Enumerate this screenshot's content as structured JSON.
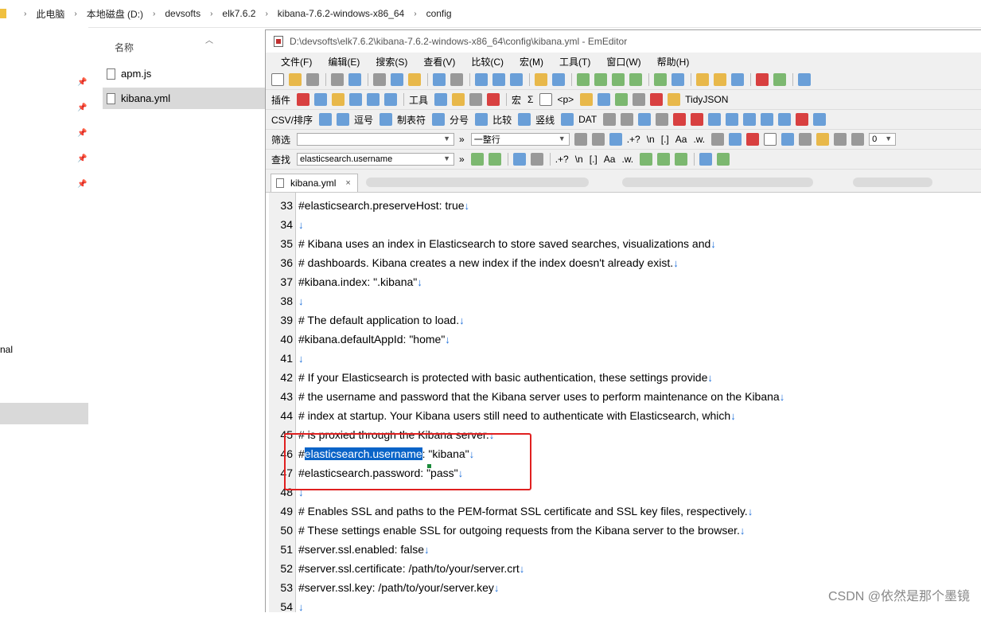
{
  "explorer": {
    "breadcrumbs": [
      "此电脑",
      "本地磁盘 (D:)",
      "devsofts",
      "elk7.6.2",
      "kibana-7.6.2-windows-x86_64",
      "config"
    ],
    "column_header": "名称",
    "files": [
      {
        "name": "apm.js",
        "selected": false
      },
      {
        "name": "kibana.yml",
        "selected": true
      }
    ],
    "nav_partial_label": "nal"
  },
  "editor": {
    "title": "D:\\devsofts\\elk7.6.2\\kibana-7.6.2-windows-x86_64\\config\\kibana.yml - EmEditor",
    "menu": [
      "文件(F)",
      "编辑(E)",
      "搜索(S)",
      "查看(V)",
      "比较(C)",
      "宏(M)",
      "工具(T)",
      "窗口(W)",
      "帮助(H)"
    ],
    "toolbar3": {
      "plugins_label": "插件",
      "tools_label": "工具",
      "macro_label": "宏",
      "sigma_label": "Σ",
      "p_label": "<p>",
      "tidyjson_label": "TidyJSON"
    },
    "toolbar4": {
      "csv_label": "CSV/排序",
      "comma_label": "逗号",
      "tab_label": "制表符",
      "semicolon_label": "分号",
      "compare_label": "比较",
      "pipe_label": "竖线",
      "dat_label": "DAT"
    },
    "filter_bar": {
      "label": "筛选",
      "value": "",
      "mode_value": "一整行",
      "regex_label": ".+?",
      "escape_label": "\\n",
      "bracket_label": "[.]",
      "case_label": "Aa",
      "word_label": ".w.",
      "count_value": "0"
    },
    "find_bar": {
      "label": "查找",
      "value": "elasticsearch.username",
      "regex_label": ".+?",
      "escape_label": "\\n",
      "bracket_label": "[.]",
      "case_label": "Aa",
      "word_label": ".w."
    },
    "tab_label": "kibana.yml",
    "tab_close": "×",
    "lines": [
      {
        "num": "33",
        "text": "#elasticsearch.preserveHost: true"
      },
      {
        "num": "34",
        "text": ""
      },
      {
        "num": "35",
        "text": "# Kibana uses an index in Elasticsearch to store saved searches, visualizations and"
      },
      {
        "num": "36",
        "text": "# dashboards. Kibana creates a new index if the index doesn't already exist."
      },
      {
        "num": "37",
        "text": "#kibana.index: \".kibana\""
      },
      {
        "num": "38",
        "text": ""
      },
      {
        "num": "39",
        "text": "# The default application to load."
      },
      {
        "num": "40",
        "text": "#kibana.defaultAppId: \"home\""
      },
      {
        "num": "41",
        "text": ""
      },
      {
        "num": "42",
        "text": "# If your Elasticsearch is protected with basic authentication, these settings provide"
      },
      {
        "num": "43",
        "text": "# the username and password that the Kibana server uses to perform maintenance on the Kibana"
      },
      {
        "num": "44",
        "text": "# index at startup. Your Kibana users still need to authenticate with Elasticsearch, which"
      },
      {
        "num": "45",
        "text": "# is proxied through the Kibana server."
      },
      {
        "num": "46",
        "text_before": "#",
        "text_selected": "elasticsearch.username",
        "text_after": ": \"kibana\""
      },
      {
        "num": "47",
        "text": "#elasticsearch.password: \"pass\""
      },
      {
        "num": "48",
        "text": ""
      },
      {
        "num": "49",
        "text": "# Enables SSL and paths to the PEM-format SSL certificate and SSL key files, respectively."
      },
      {
        "num": "50",
        "text": "# These settings enable SSL for outgoing requests from the Kibana server to the browser."
      },
      {
        "num": "51",
        "text": "#server.ssl.enabled: false"
      },
      {
        "num": "52",
        "text": "#server.ssl.certificate: /path/to/your/server.crt"
      },
      {
        "num": "53",
        "text": "#server.ssl.key: /path/to/your/server.key"
      },
      {
        "num": "54",
        "text": ""
      }
    ],
    "eol_mark": "↓"
  },
  "watermark": "CSDN @依然是那个墨镜",
  "colors": {
    "selection": "#0a64c8",
    "eol_mark": "#1e6fd9",
    "annotation_box": "#e02020"
  }
}
